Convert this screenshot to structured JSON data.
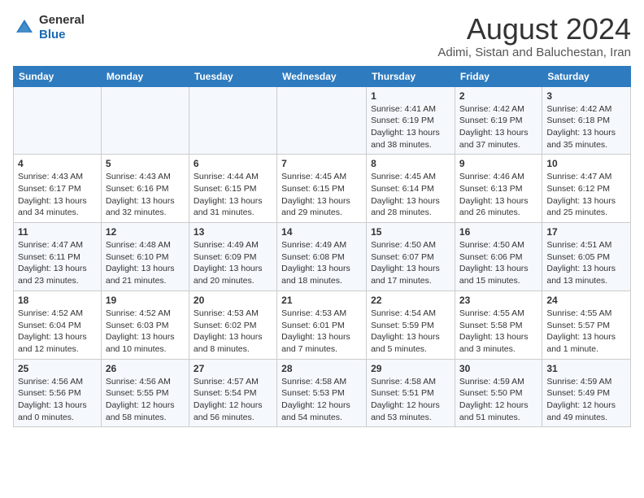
{
  "header": {
    "logo_line1": "General",
    "logo_line2": "Blue",
    "month_year": "August 2024",
    "location": "Adimi, Sistan and Baluchestan, Iran"
  },
  "weekdays": [
    "Sunday",
    "Monday",
    "Tuesday",
    "Wednesday",
    "Thursday",
    "Friday",
    "Saturday"
  ],
  "rows": [
    [
      {
        "day": "",
        "info": ""
      },
      {
        "day": "",
        "info": ""
      },
      {
        "day": "",
        "info": ""
      },
      {
        "day": "",
        "info": ""
      },
      {
        "day": "1",
        "info": "Sunrise: 4:41 AM\nSunset: 6:19 PM\nDaylight: 13 hours\nand 38 minutes."
      },
      {
        "day": "2",
        "info": "Sunrise: 4:42 AM\nSunset: 6:19 PM\nDaylight: 13 hours\nand 37 minutes."
      },
      {
        "day": "3",
        "info": "Sunrise: 4:42 AM\nSunset: 6:18 PM\nDaylight: 13 hours\nand 35 minutes."
      }
    ],
    [
      {
        "day": "4",
        "info": "Sunrise: 4:43 AM\nSunset: 6:17 PM\nDaylight: 13 hours\nand 34 minutes."
      },
      {
        "day": "5",
        "info": "Sunrise: 4:43 AM\nSunset: 6:16 PM\nDaylight: 13 hours\nand 32 minutes."
      },
      {
        "day": "6",
        "info": "Sunrise: 4:44 AM\nSunset: 6:15 PM\nDaylight: 13 hours\nand 31 minutes."
      },
      {
        "day": "7",
        "info": "Sunrise: 4:45 AM\nSunset: 6:15 PM\nDaylight: 13 hours\nand 29 minutes."
      },
      {
        "day": "8",
        "info": "Sunrise: 4:45 AM\nSunset: 6:14 PM\nDaylight: 13 hours\nand 28 minutes."
      },
      {
        "day": "9",
        "info": "Sunrise: 4:46 AM\nSunset: 6:13 PM\nDaylight: 13 hours\nand 26 minutes."
      },
      {
        "day": "10",
        "info": "Sunrise: 4:47 AM\nSunset: 6:12 PM\nDaylight: 13 hours\nand 25 minutes."
      }
    ],
    [
      {
        "day": "11",
        "info": "Sunrise: 4:47 AM\nSunset: 6:11 PM\nDaylight: 13 hours\nand 23 minutes."
      },
      {
        "day": "12",
        "info": "Sunrise: 4:48 AM\nSunset: 6:10 PM\nDaylight: 13 hours\nand 21 minutes."
      },
      {
        "day": "13",
        "info": "Sunrise: 4:49 AM\nSunset: 6:09 PM\nDaylight: 13 hours\nand 20 minutes."
      },
      {
        "day": "14",
        "info": "Sunrise: 4:49 AM\nSunset: 6:08 PM\nDaylight: 13 hours\nand 18 minutes."
      },
      {
        "day": "15",
        "info": "Sunrise: 4:50 AM\nSunset: 6:07 PM\nDaylight: 13 hours\nand 17 minutes."
      },
      {
        "day": "16",
        "info": "Sunrise: 4:50 AM\nSunset: 6:06 PM\nDaylight: 13 hours\nand 15 minutes."
      },
      {
        "day": "17",
        "info": "Sunrise: 4:51 AM\nSunset: 6:05 PM\nDaylight: 13 hours\nand 13 minutes."
      }
    ],
    [
      {
        "day": "18",
        "info": "Sunrise: 4:52 AM\nSunset: 6:04 PM\nDaylight: 13 hours\nand 12 minutes."
      },
      {
        "day": "19",
        "info": "Sunrise: 4:52 AM\nSunset: 6:03 PM\nDaylight: 13 hours\nand 10 minutes."
      },
      {
        "day": "20",
        "info": "Sunrise: 4:53 AM\nSunset: 6:02 PM\nDaylight: 13 hours\nand 8 minutes."
      },
      {
        "day": "21",
        "info": "Sunrise: 4:53 AM\nSunset: 6:01 PM\nDaylight: 13 hours\nand 7 minutes."
      },
      {
        "day": "22",
        "info": "Sunrise: 4:54 AM\nSunset: 5:59 PM\nDaylight: 13 hours\nand 5 minutes."
      },
      {
        "day": "23",
        "info": "Sunrise: 4:55 AM\nSunset: 5:58 PM\nDaylight: 13 hours\nand 3 minutes."
      },
      {
        "day": "24",
        "info": "Sunrise: 4:55 AM\nSunset: 5:57 PM\nDaylight: 13 hours\nand 1 minute."
      }
    ],
    [
      {
        "day": "25",
        "info": "Sunrise: 4:56 AM\nSunset: 5:56 PM\nDaylight: 13 hours\nand 0 minutes."
      },
      {
        "day": "26",
        "info": "Sunrise: 4:56 AM\nSunset: 5:55 PM\nDaylight: 12 hours\nand 58 minutes."
      },
      {
        "day": "27",
        "info": "Sunrise: 4:57 AM\nSunset: 5:54 PM\nDaylight: 12 hours\nand 56 minutes."
      },
      {
        "day": "28",
        "info": "Sunrise: 4:58 AM\nSunset: 5:53 PM\nDaylight: 12 hours\nand 54 minutes."
      },
      {
        "day": "29",
        "info": "Sunrise: 4:58 AM\nSunset: 5:51 PM\nDaylight: 12 hours\nand 53 minutes."
      },
      {
        "day": "30",
        "info": "Sunrise: 4:59 AM\nSunset: 5:50 PM\nDaylight: 12 hours\nand 51 minutes."
      },
      {
        "day": "31",
        "info": "Sunrise: 4:59 AM\nSunset: 5:49 PM\nDaylight: 12 hours\nand 49 minutes."
      }
    ]
  ]
}
